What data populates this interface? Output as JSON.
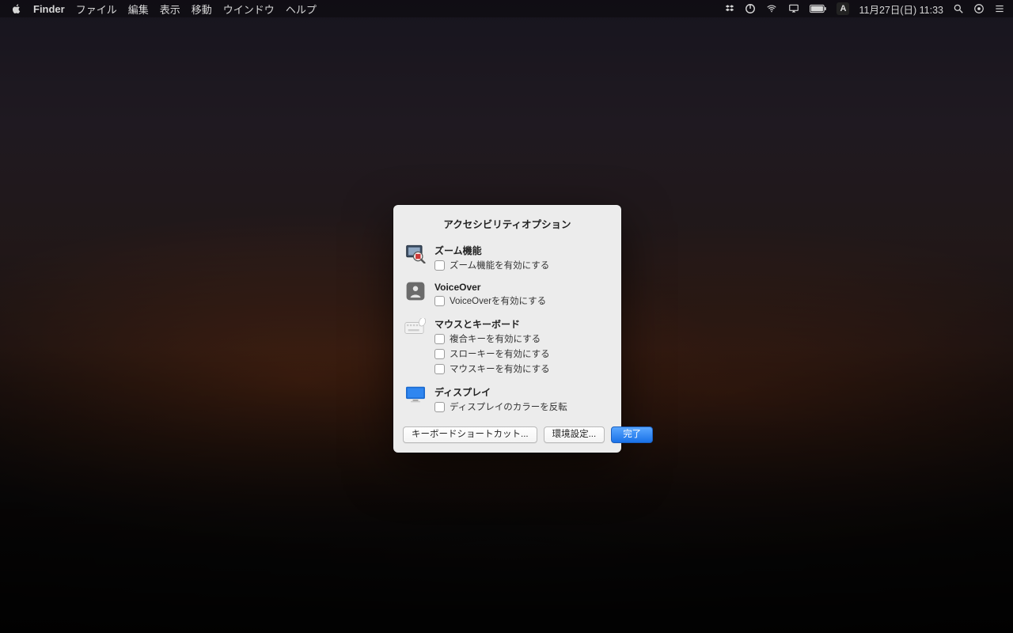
{
  "menubar": {
    "app_name": "Finder",
    "items": [
      "ファイル",
      "編集",
      "表示",
      "移動",
      "ウインドウ",
      "ヘルプ"
    ],
    "ime_label": "A",
    "date_time": "11月27日(日) 11:33"
  },
  "dialog": {
    "title": "アクセシビリティオプション",
    "sections": {
      "zoom": {
        "heading": "ズーム機能",
        "options": [
          "ズーム機能を有効にする"
        ]
      },
      "voiceover": {
        "heading": "VoiceOver",
        "options": [
          "VoiceOverを有効にする"
        ]
      },
      "mouse_keyboard": {
        "heading": "マウスとキーボード",
        "options": [
          "複合キーを有効にする",
          "スローキーを有効にする",
          "マウスキーを有効にする"
        ]
      },
      "display": {
        "heading": "ディスプレイ",
        "options": [
          "ディスプレイのカラーを反転"
        ]
      }
    },
    "buttons": {
      "shortcuts": "キーボードショートカット...",
      "preferences": "環境設定...",
      "done": "完了"
    }
  }
}
